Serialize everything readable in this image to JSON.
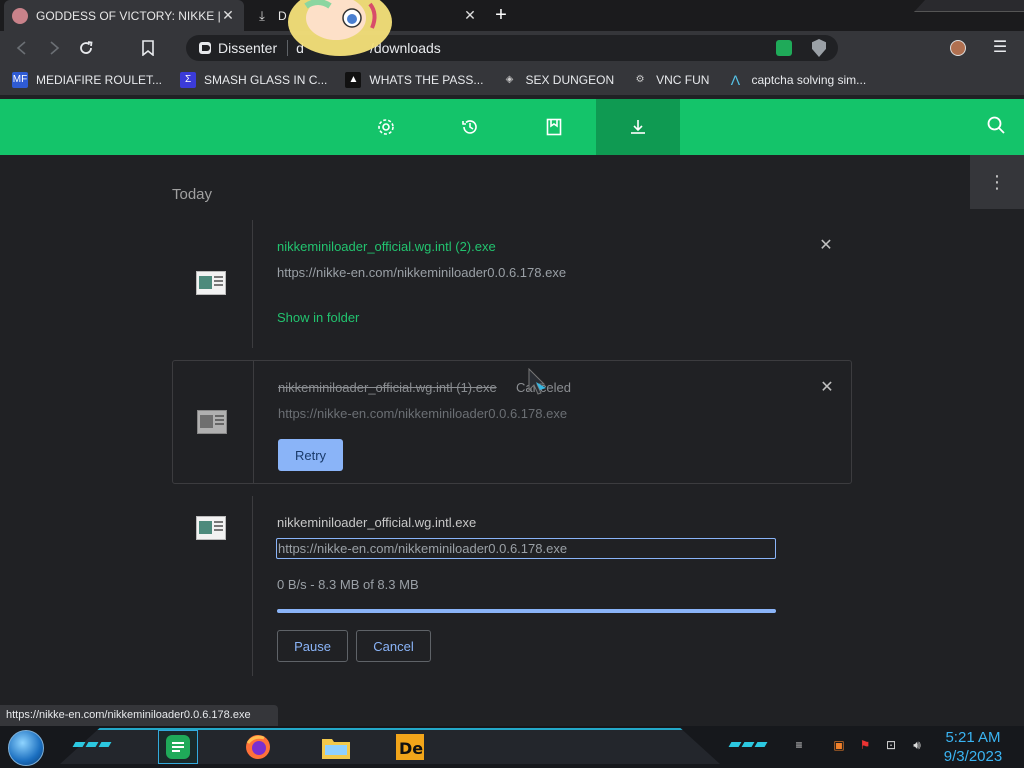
{
  "tabs": [
    {
      "title": "GODDESS OF VICTORY: NIKKE | In",
      "active": true
    },
    {
      "title": "D",
      "active": false
    }
  ],
  "toolbar": {
    "site_name": "Dissenter",
    "url_prefix": "d",
    "url_path": "/downloads"
  },
  "bookmarks": [
    {
      "label": "MEDIAFIRE ROULET...",
      "icon": "mediafire-icon",
      "color": "#2f5bd3"
    },
    {
      "label": "SMASH GLASS IN C...",
      "icon": "sigma-icon",
      "color": "#3b3bd8"
    },
    {
      "label": "WHATS THE PASS...",
      "icon": "hat-icon",
      "color": "#111111"
    },
    {
      "label": "SEX DUNGEON",
      "icon": "cube-icon",
      "color": "#cccccc"
    },
    {
      "label": "VNC FUN",
      "icon": "gear-icon",
      "color": "#cccccc"
    },
    {
      "label": "captcha solving sim...",
      "icon": "lambda-icon",
      "color": "#56c2e6"
    }
  ],
  "downloads_header": {
    "buttons": [
      "settings-icon",
      "history-icon",
      "bookmarks-icon",
      "download-icon"
    ],
    "active_index": 3,
    "accent": "#14c46a"
  },
  "section_title": "Today",
  "items": [
    {
      "filename": "nikkeminiloader_official.wg.intl (2).exe",
      "url": "https://nikke-en.com/nikkeminiloader0.0.6.178.exe",
      "action": "Show in folder",
      "status": ""
    },
    {
      "filename": "nikkeminiloader_official.wg.intl (1).exe",
      "url": "https://nikke-en.com/nikkeminiloader0.0.6.178.exe",
      "status": "Canceled",
      "action": "Retry"
    },
    {
      "filename": "nikkeminiloader_official.wg.intl.exe",
      "url": "https://nikke-en.com/nikkeminiloader0.0.6.178.exe",
      "progress_text": "0 B/s - 8.3 MB of 8.3 MB",
      "progress_fraction": 1.0,
      "pause_label": "Pause",
      "cancel_label": "Cancel"
    }
  ],
  "status_bubble": "https://nikke-en.com/nikkeminiloader0.0.6.178.exe",
  "clock": {
    "time": "5:21 AM",
    "date": "9/3/2023"
  }
}
